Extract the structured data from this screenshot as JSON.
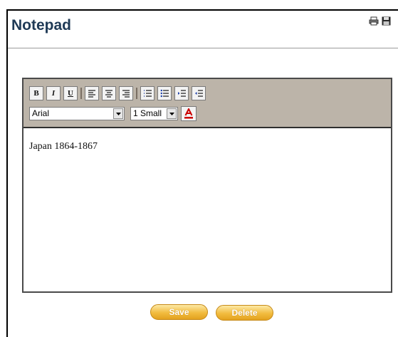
{
  "window": {
    "title": "Notepad"
  },
  "header_icons": [
    "print-icon",
    "save-disk-icon"
  ],
  "toolbar": {
    "format_buttons": [
      {
        "name": "bold-button",
        "label": "B"
      },
      {
        "name": "italic-button",
        "label": "I"
      },
      {
        "name": "underline-button",
        "label": "U"
      }
    ],
    "align_buttons": [
      "align-left-icon",
      "align-center-icon",
      "align-right-icon"
    ],
    "list_buttons": [
      "numbered-list-icon",
      "bulleted-list-icon",
      "indent-icon",
      "outdent-icon"
    ],
    "font_select": {
      "value": "Arial"
    },
    "size_select": {
      "value": "1 Small"
    },
    "text_color_icon": "font-color-icon",
    "accent_color": "#cc0000"
  },
  "editor": {
    "content": "Japan 1864-1867"
  },
  "actions": {
    "save_label": "Save",
    "delete_label": "Delete"
  },
  "colors": {
    "toolbar_bg": "#bcb4a9",
    "button_gold": "#f2bc3f",
    "title": "#1f3a56"
  }
}
